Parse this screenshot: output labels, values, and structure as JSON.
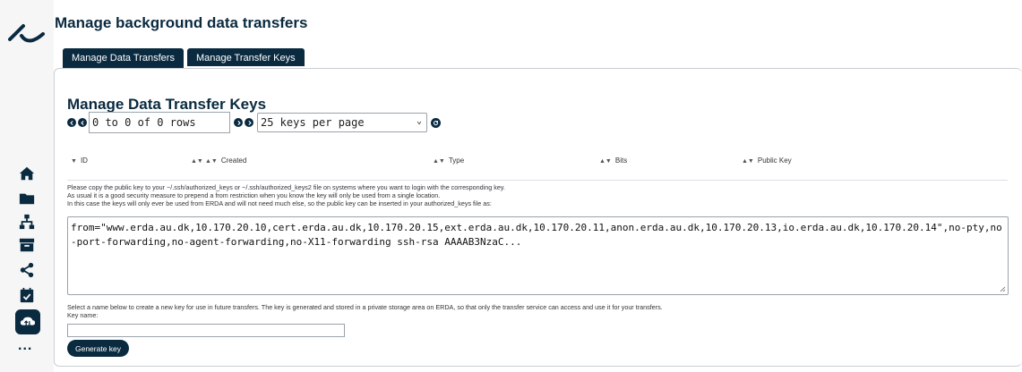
{
  "page": {
    "title": "Manage background data transfers"
  },
  "tabs": [
    {
      "label": "Manage Data Transfers",
      "active": false
    },
    {
      "label": "Manage Transfer Keys",
      "active": true
    }
  ],
  "section": {
    "title": "Manage Data Transfer Keys"
  },
  "pager": {
    "range_value": "0 to 0 of 0 rows",
    "per_page": "25 keys per page"
  },
  "table": {
    "columns": [
      "ID",
      "Created",
      "Type",
      "Bits",
      "Public Key"
    ]
  },
  "info": {
    "line1": "Please copy the public key to your ~/.ssh/authorized_keys or ~/.ssh/authorized_keys2 file on systems where you want to login with the corresponding key.",
    "line2": "As usual it is a good security measure to prepend a from restriction when you know the key will only be used from a single location.",
    "line3": "In this case the keys will only ever be used from ERDA and will not need much else, so the public key can be inserted in your authorized_keys file as:"
  },
  "key_text": "from=\"www.erda.au.dk,10.170.20.10,cert.erda.au.dk,10.170.20.15,ext.erda.au.dk,10.170.20.11,anon.erda.au.dk,10.170.20.13,io.erda.au.dk,10.170.20.14\",no-pty,no-port-forwarding,no-agent-forwarding,no-X11-forwarding ssh-rsa AAAAB3NzaC...",
  "create": {
    "info": "Select a name below to create a new key for use in future transfers. The key is generated and stored in a private storage area on ERDA, so that only the transfer service can access and use it for your transfers.",
    "label": "Key name:",
    "key_name_value": "",
    "button": "Generate key"
  },
  "sidebar": {
    "icons": [
      "home-icon",
      "folder-icon",
      "sitemap-icon",
      "archive-icon",
      "share-icon",
      "calendar-check-icon",
      "cloud-transfer-icon",
      "more-icon"
    ],
    "active": "cloud-transfer-icon",
    "more_label": "..."
  },
  "colors": {
    "accent": "#0a2a40"
  }
}
